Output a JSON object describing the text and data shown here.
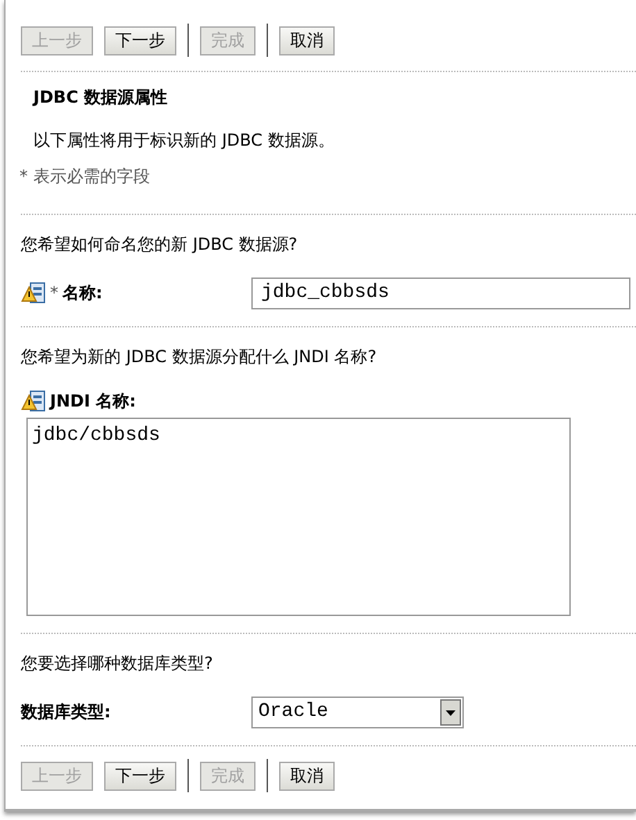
{
  "top_buttons": [
    {
      "label": "上一步",
      "disabled": true
    },
    {
      "label": "下一步",
      "disabled": false
    },
    {
      "label": "完成",
      "disabled": true
    },
    {
      "label": "取消",
      "disabled": false
    }
  ],
  "title": "JDBC 数据源属性",
  "description": "以下属性将用于标识新的 JDBC 数据源。",
  "required_note": "* 表示必需的字段",
  "sections": [
    {
      "kind": "input",
      "question": "您希望如何命名您的新 JDBC 数据源?",
      "label": "名称:",
      "required_mark": "*",
      "value": "jdbc_cbbsds"
    },
    {
      "kind": "textarea",
      "question": "您希望为新的 JDBC 数据源分配什么 JNDI 名称?",
      "label": "JNDI 名称:",
      "value": "jdbc/cbbsds"
    },
    {
      "kind": "select",
      "question": "您要选择哪种数据库类型?",
      "label": "数据库类型:",
      "value": "Oracle"
    }
  ],
  "bottom_buttons": [
    {
      "label": "上一步",
      "disabled": true
    },
    {
      "label": "下一步",
      "disabled": false
    },
    {
      "label": "完成",
      "disabled": true
    },
    {
      "label": "取消",
      "disabled": false
    }
  ]
}
